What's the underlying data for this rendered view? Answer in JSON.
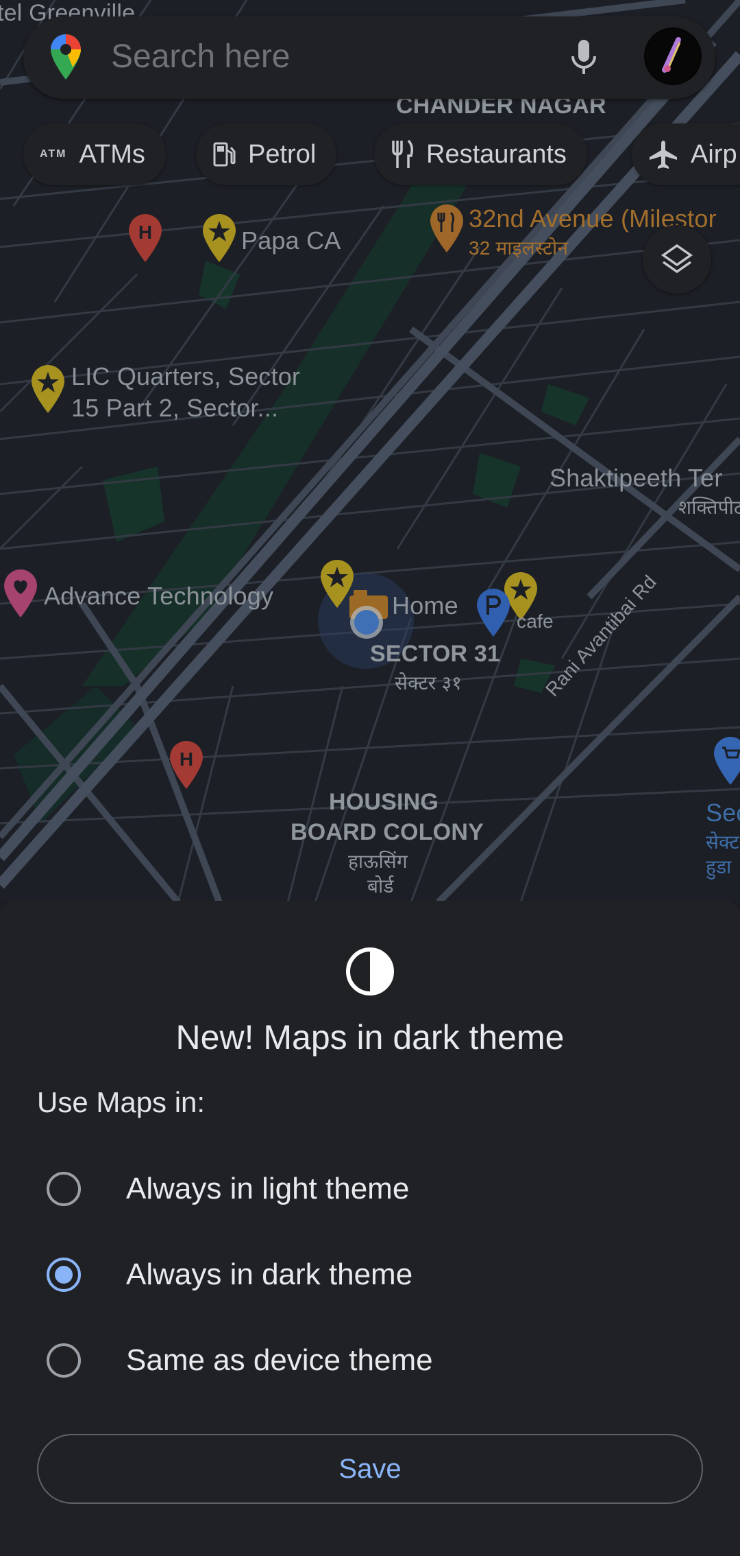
{
  "search": {
    "placeholder": "Search here"
  },
  "chips": [
    {
      "icon": "atm-icon",
      "label": "ATMs",
      "icon_text": "ATM"
    },
    {
      "icon": "fuel-icon",
      "label": "Petrol"
    },
    {
      "icon": "restaurant-icon",
      "label": "Restaurants"
    },
    {
      "icon": "airplane-icon",
      "label": "Airp"
    }
  ],
  "map": {
    "labels": {
      "greenville": "tel Greenville",
      "chander_nagar": "CHANDER NAGAR",
      "papa_ca": "Papa CA",
      "avenue": "32nd Avenue (Milestor",
      "avenue_hi": "32 माइलस्टोन",
      "lic_1": "LIC Quarters, Sector",
      "lic_2": "15 Part 2, Sector...",
      "shaktipeeth": "Shaktipeeth Ter",
      "shaktipeeth_hi": "शक्तिपीठ",
      "advance": "Advance Technology",
      "home": "Home",
      "cafe": "cafe",
      "sector31": "SECTOR 31",
      "sector31_hi": "सेक्टर ३१",
      "rani": "Rani Avantibai Rd",
      "housing_1": "HOUSING",
      "housing_2": "BOARD COLONY",
      "housing_hi1": "हाऊसिंग",
      "housing_hi2": "बोर्ड",
      "sec_right": "Sec",
      "sec_right_hi1": "सेक्ट",
      "sec_right_hi2": "हुडा"
    }
  },
  "sheet": {
    "icon": "contrast-icon",
    "title": "New! Maps in dark theme",
    "subtitle": "Use Maps in:",
    "options": [
      {
        "label": "Always in light theme",
        "selected": false
      },
      {
        "label": "Always in dark theme",
        "selected": true
      },
      {
        "label": "Same as device theme",
        "selected": false
      }
    ],
    "save_label": "Save"
  },
  "colors": {
    "accent": "#8ab4f8",
    "sheet_bg": "#202124",
    "map_bg": "#1c1f26"
  }
}
